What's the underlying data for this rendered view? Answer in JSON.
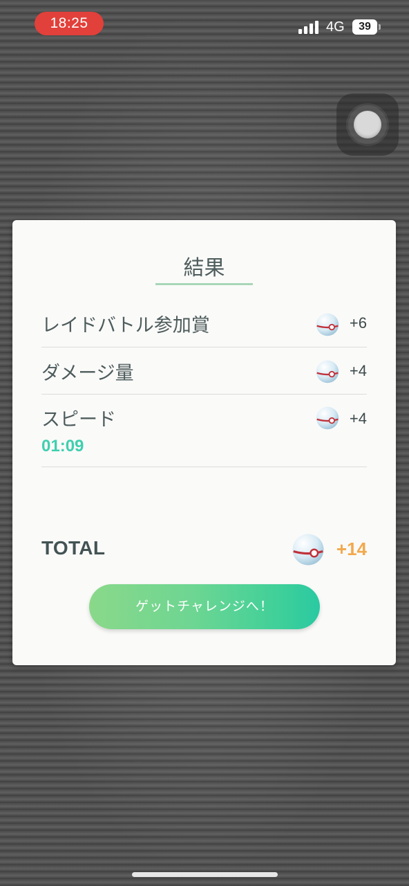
{
  "status_bar": {
    "time": "18:25",
    "network": "4G",
    "battery": "39"
  },
  "result": {
    "title": "結果",
    "rows": [
      {
        "label": "レイドバトル参加賞",
        "value": "+6"
      },
      {
        "label": "ダメージ量",
        "value": "+4"
      },
      {
        "label": "スピード",
        "value": "+4",
        "sub": "01:09"
      }
    ],
    "total_label": "TOTAL",
    "total_value": "+14",
    "button_label": "ゲットチャレンジへ！"
  },
  "icons": {
    "reward_ball": "premier-ball-icon",
    "assistive": "assistive-touch-icon"
  },
  "colors": {
    "status_time_bg": "#e2403a",
    "speed_time": "#3fcfae",
    "total_value": "#f2a94c",
    "button_start": "#8ad88a",
    "button_end": "#2ac9a2",
    "ball_band": "#c0313a"
  }
}
